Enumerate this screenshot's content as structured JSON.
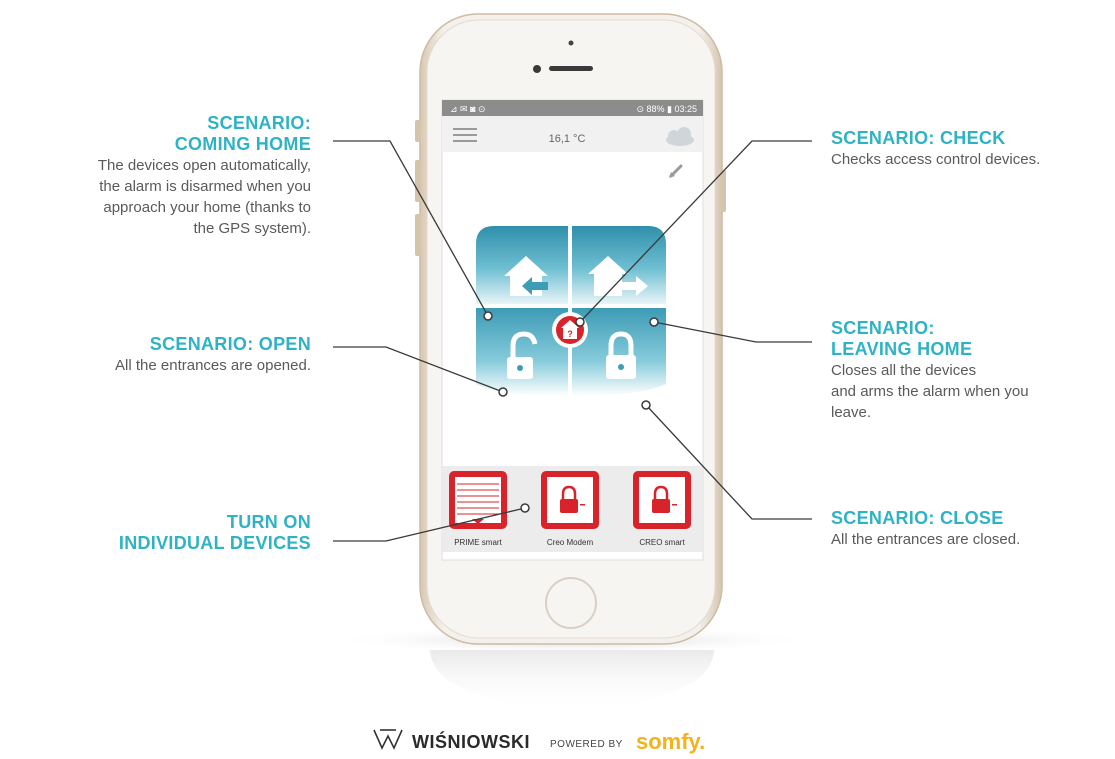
{
  "status_bar": {
    "left": "⊿ ✉ ◙ ⊙",
    "right": "⊙ 88% ▮ 03:25"
  },
  "header": {
    "temperature": "16,1 °C"
  },
  "devices": [
    {
      "label": "PRIME smart"
    },
    {
      "label": "Creo Modem"
    },
    {
      "label": "CREO smart"
    }
  ],
  "annotations": {
    "coming_home": {
      "title_1": "SCENARIO:",
      "title_2": "COMING HOME",
      "lines": [
        "The devices open automatically,",
        "the alarm is disarmed when you",
        "approach your home (thanks to",
        "the GPS system)."
      ]
    },
    "open": {
      "title": "SCENARIO: OPEN",
      "text": "All the entrances are opened."
    },
    "individual": {
      "title_1": "TURN ON",
      "title_2": "INDIVIDUAL DEVICES"
    },
    "check": {
      "title": "SCENARIO: CHECK",
      "text": "Checks access control devices."
    },
    "leaving_home": {
      "title_1": "SCENARIO:",
      "title_2": "LEAVING HOME",
      "lines": [
        "Closes all the devices",
        "and arms the alarm when you",
        "leave."
      ]
    },
    "close": {
      "title": "SCENARIO: CLOSE",
      "text": "All the entrances are closed."
    }
  },
  "branding": {
    "wisniowski": "WIŚNIOWSKI",
    "powered_by": "POWERED BY",
    "somfy": "somfy."
  },
  "colors": {
    "accent": "#2fb3c4",
    "device_red": "#d9232a",
    "tile_blue": "#3d9db5",
    "text": "#5a5a5a"
  }
}
